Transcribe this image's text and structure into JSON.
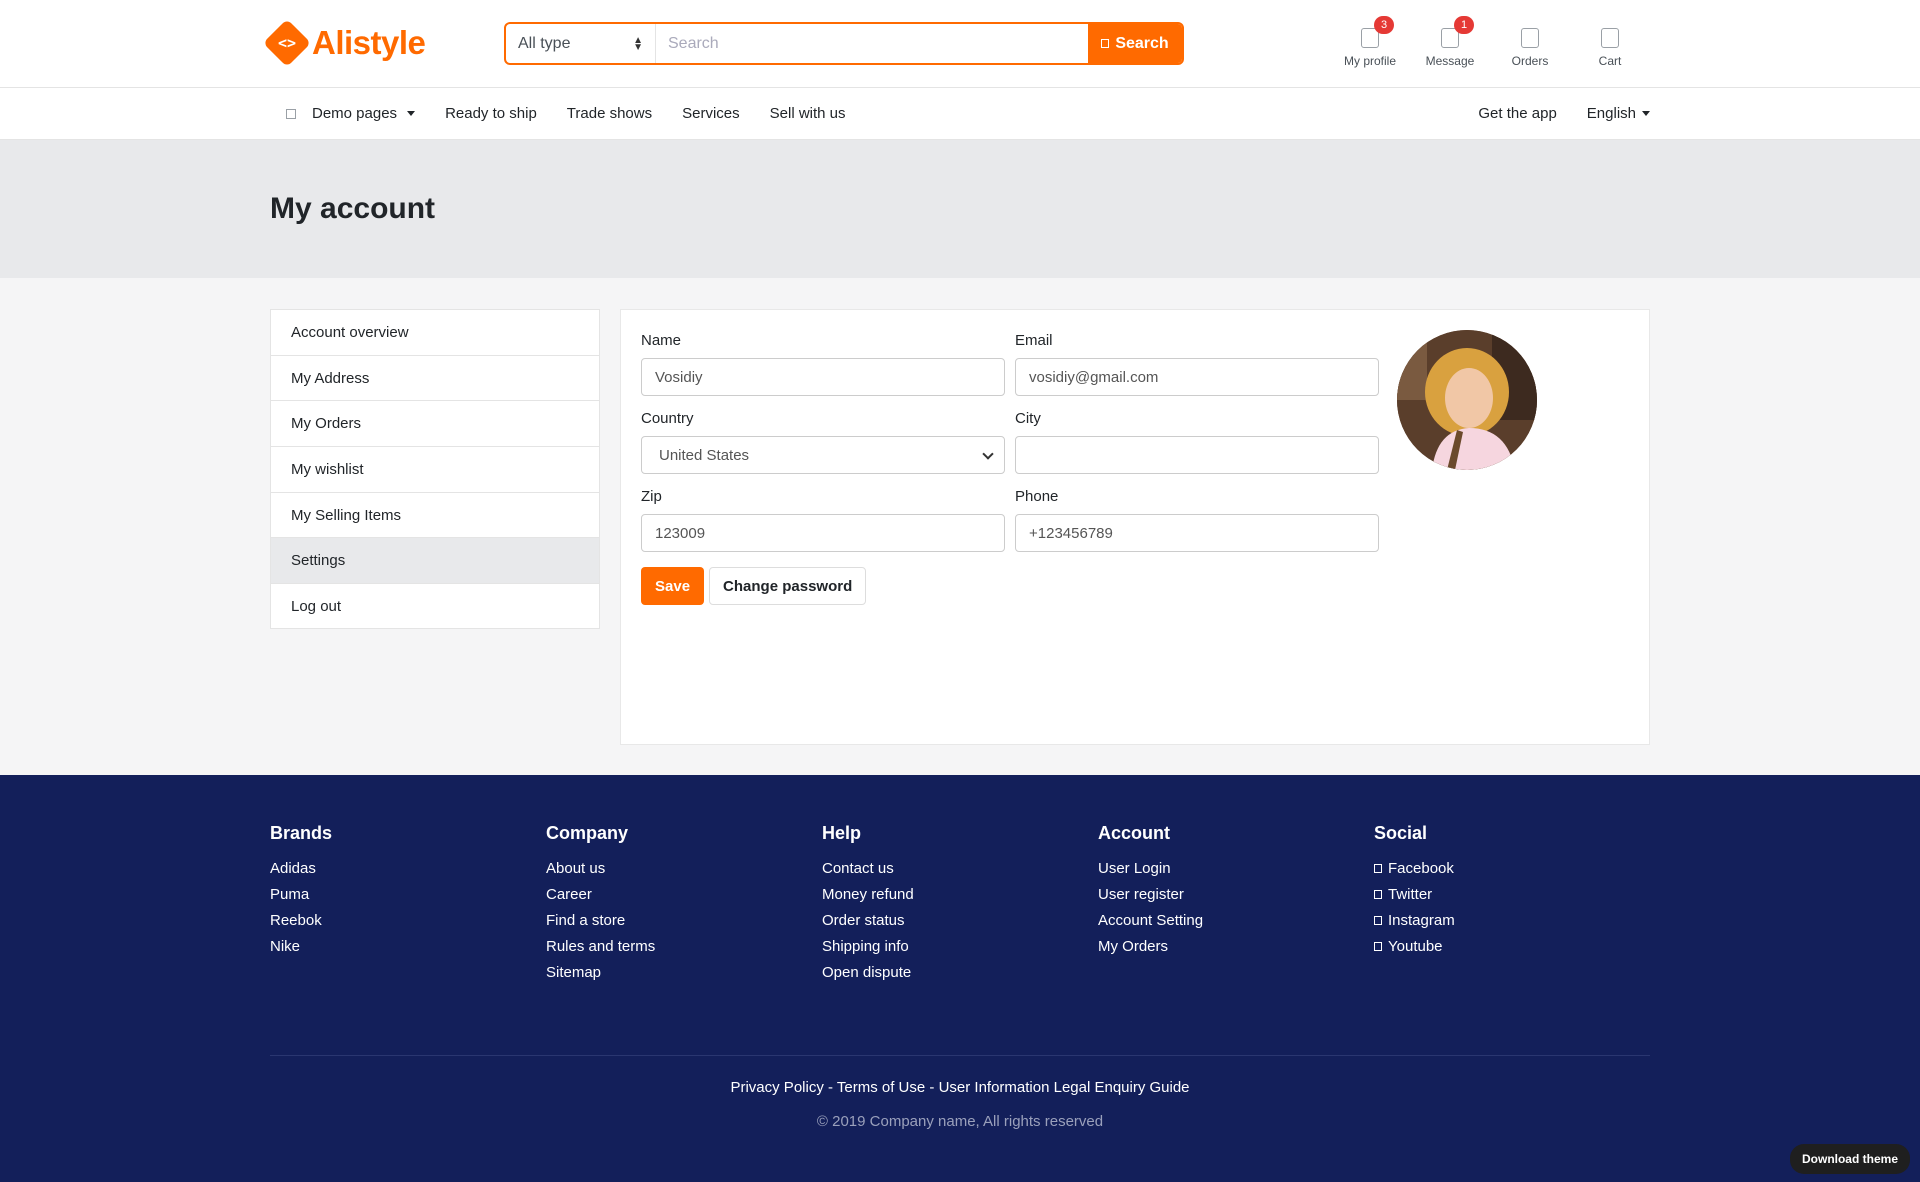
{
  "brand": {
    "name": "Alistyle",
    "logo_glyph": "<>"
  },
  "search": {
    "type_selected": "All type",
    "placeholder": "Search",
    "button_label": "Search"
  },
  "widgets": [
    {
      "label": "My profile",
      "badge": "3",
      "icon": "user-icon"
    },
    {
      "label": "Message",
      "badge": "1",
      "icon": "message-icon"
    },
    {
      "label": "Orders",
      "badge": "",
      "icon": "orders-icon"
    },
    {
      "label": "Cart",
      "badge": "",
      "icon": "cart-icon"
    }
  ],
  "nav": {
    "items": [
      "Demo pages",
      "Ready to ship",
      "Trade shows",
      "Services",
      "Sell with us"
    ],
    "right": [
      "Get the app",
      "English"
    ]
  },
  "page": {
    "title": "My account"
  },
  "sidebar": {
    "items": [
      {
        "label": "Account overview",
        "active": false
      },
      {
        "label": "My Address",
        "active": false
      },
      {
        "label": "My Orders",
        "active": false
      },
      {
        "label": "My wishlist",
        "active": false
      },
      {
        "label": "My Selling Items",
        "active": false
      },
      {
        "label": "Settings",
        "active": true
      },
      {
        "label": "Log out",
        "active": false
      }
    ]
  },
  "form": {
    "name": {
      "label": "Name",
      "value": "Vosidiy"
    },
    "email": {
      "label": "Email",
      "value": "vosidiy@gmail.com"
    },
    "country": {
      "label": "Country",
      "value": "United States"
    },
    "city": {
      "label": "City",
      "value": ""
    },
    "zip": {
      "label": "Zip",
      "value": "123009"
    },
    "phone": {
      "label": "Phone",
      "value": "+123456789"
    },
    "save_label": "Save",
    "change_password_label": "Change password"
  },
  "footer": {
    "columns": [
      {
        "title": "Brands",
        "links": [
          "Adidas",
          "Puma",
          "Reebok",
          "Nike"
        ]
      },
      {
        "title": "Company",
        "links": [
          "About us",
          "Career",
          "Find a store",
          "Rules and terms",
          "Sitemap"
        ]
      },
      {
        "title": "Help",
        "links": [
          "Contact us",
          "Money refund",
          "Order status",
          "Shipping info",
          "Open dispute"
        ]
      },
      {
        "title": "Account",
        "links": [
          "User Login",
          "User register",
          "Account Setting",
          "My Orders"
        ]
      },
      {
        "title": "Social",
        "links": [
          "Facebook",
          "Twitter",
          "Instagram",
          "Youtube"
        ]
      }
    ],
    "legal": "Privacy Policy - Terms of Use - User Information Legal Enquiry Guide",
    "copyright": "© 2019 Company name, All rights reserved",
    "download_label": "Download theme"
  },
  "colors": {
    "accent": "#ff6a00",
    "footer_bg": "#131f5a",
    "badge": "#e53935"
  }
}
